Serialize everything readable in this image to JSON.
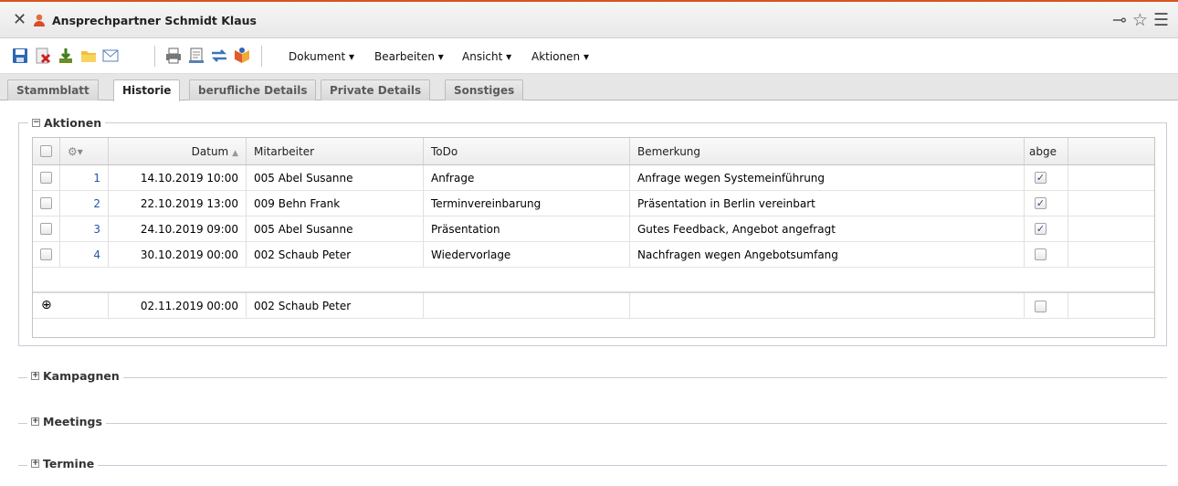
{
  "window": {
    "title": "Ansprechpartner Schmidt Klaus",
    "close_icon": "close-icon",
    "person_icon": "contact-person-icon",
    "right_icons": [
      "pin-icon",
      "star-icon",
      "menu-icon"
    ]
  },
  "toolbar": {
    "icons": [
      "save-icon",
      "delete-icon",
      "download-icon",
      "folder-icon",
      "email-icon",
      "print-icon",
      "scan-icon",
      "transfer-icon",
      "merge-icon"
    ],
    "menus": [
      "Dokument ▾",
      "Bearbeiten ▾",
      "Ansicht ▾",
      "Aktionen ▾"
    ]
  },
  "tabs": [
    "Stammblatt",
    "Historie",
    "berufliche Details",
    "Private Details",
    "Sonstiges"
  ],
  "active_tab": "Historie",
  "aktionen": {
    "legend": "Aktionen",
    "toggle": "−",
    "columns": {
      "date": "Datum",
      "date_sort": "▲",
      "employee": "Mitarbeiter",
      "todo": "ToDo",
      "remark": "Bemerkung",
      "done": "abge"
    },
    "rows": [
      {
        "num": "1",
        "date": "14.10.2019 10:00",
        "employee": "005 Abel Susanne",
        "todo": "Anfrage",
        "remark": "Anfrage wegen Systemeinführung",
        "done": true
      },
      {
        "num": "2",
        "date": "22.10.2019 13:00",
        "employee": "009 Behn Frank",
        "todo": "Terminvereinbarung",
        "remark": "Präsentation in Berlin vereinbart",
        "done": true
      },
      {
        "num": "3",
        "date": "24.10.2019 09:00",
        "employee": "005 Abel Susanne",
        "todo": "Präsentation",
        "remark": "Gutes Feedback, Angebot angefragt",
        "done": true
      },
      {
        "num": "4",
        "date": "30.10.2019 00:00",
        "employee": "002 Schaub Peter",
        "todo": "Wiedervorlage",
        "remark": "Nachfragen wegen Angebotsumfang",
        "done": false
      }
    ],
    "new_row": {
      "add_icon": "⊕",
      "date": "02.11.2019 00:00",
      "employee": "002 Schaub Peter",
      "todo": "",
      "remark": "",
      "done": false
    }
  },
  "sections": [
    {
      "legend": "Kampagnen",
      "toggle": "+"
    },
    {
      "legend": "Meetings",
      "toggle": "+"
    },
    {
      "legend": "Termine",
      "toggle": "+"
    }
  ],
  "colors": {
    "accent_top": "#d9531e",
    "link_blue": "#2255aa",
    "check_blue": "#2b4f8a"
  }
}
